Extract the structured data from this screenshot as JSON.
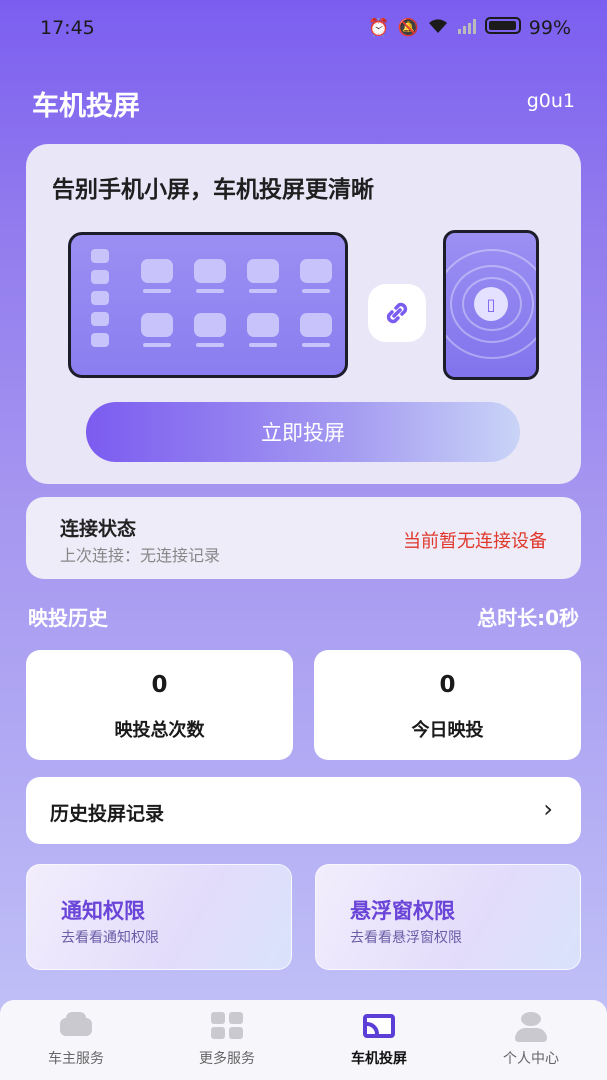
{
  "status_bar": {
    "time": "17:45",
    "battery": "99%",
    "icons": [
      "alarm-icon",
      "mute-icon",
      "wifi-icon",
      "signal-icon",
      "battery-icon"
    ]
  },
  "header": {
    "title": "车机投屏",
    "user": "g0u1"
  },
  "hero": {
    "title": "告别手机小屏，车机投屏更清晰",
    "cast_button": "立即投屏"
  },
  "connection": {
    "title": "连接状态",
    "last_label": "上次连接：",
    "last_value": "无连接记录",
    "status": "当前暂无连接设备"
  },
  "history": {
    "title": "映投历史",
    "total_duration": "总时长:0秒",
    "stats": [
      {
        "value": "0",
        "label": "映投总次数"
      },
      {
        "value": "0",
        "label": "今日映投"
      }
    ],
    "records_label": "历史投屏记录"
  },
  "permissions": [
    {
      "title": "通知权限",
      "subtitle": "去看看通知权限"
    },
    {
      "title": "悬浮窗权限",
      "subtitle": "去看看悬浮窗权限"
    }
  ],
  "bottom_nav": {
    "items": [
      {
        "label": "车主服务",
        "icon": "car-icon"
      },
      {
        "label": "更多服务",
        "icon": "grid-icon"
      },
      {
        "label": "车机投屏",
        "icon": "cast-icon"
      },
      {
        "label": "个人中心",
        "icon": "person-icon"
      }
    ],
    "active_index": 2
  },
  "colors": {
    "accent": "#7b5cf0",
    "alert": "#e0392c",
    "permission_title": "#6a45d8"
  }
}
